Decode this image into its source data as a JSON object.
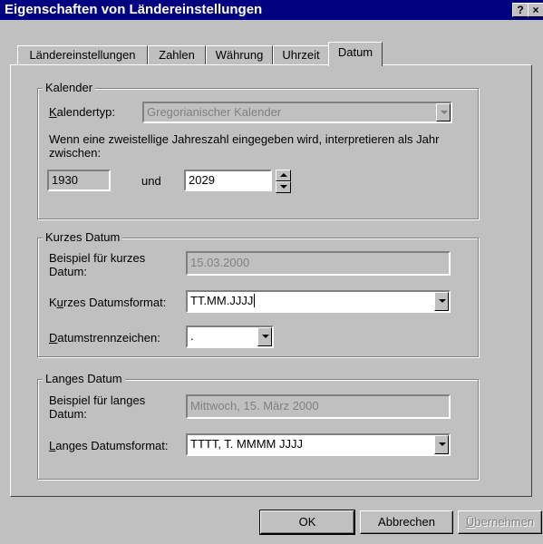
{
  "window": {
    "title": "Eigenschaften von Ländereinstellungen",
    "help_button": "?",
    "close_button": "×"
  },
  "tabs": [
    {
      "label": "Ländereinstellungen",
      "active": false
    },
    {
      "label": "Zahlen",
      "active": false
    },
    {
      "label": "Währung",
      "active": false
    },
    {
      "label": "Uhrzeit",
      "active": false
    },
    {
      "label": "Datum",
      "active": true
    }
  ],
  "kalender": {
    "legend": "Kalender",
    "typ_label_rest": "alendertyp:",
    "typ_label_accel": "K",
    "typ_value": "Gregorianischer Kalender",
    "info_text": "Wenn eine zweistellige Jahreszahl eingegeben wird, interpretieren als Jahr zwischen:",
    "year_from": "1930",
    "und": "und",
    "year_to": "2029"
  },
  "kurzes_datum": {
    "legend": "Kurzes Datum",
    "example_label": "Beispiel für kurzes Datum:",
    "example_value": "15.03.2000",
    "format_label_pre": "K",
    "format_label_accel": "u",
    "format_label_post": "rzes Datumsformat:",
    "format_value": "TT.MM.JJJJ",
    "separator_label_accel": "D",
    "separator_label_rest": "atumstrennzeichen:",
    "separator_value": "."
  },
  "langes_datum": {
    "legend": "Langes Datum",
    "example_label": "Beispiel für langes Datum:",
    "example_value": "Mittwoch, 15. März 2000",
    "format_label_accel": "L",
    "format_label_rest": "anges Datumsformat:",
    "format_value": "TTTT, T. MMMM JJJJ"
  },
  "buttons": {
    "ok": "OK",
    "cancel": "Abbrechen",
    "apply_accel": "Ü",
    "apply_rest": "bernehmen"
  }
}
